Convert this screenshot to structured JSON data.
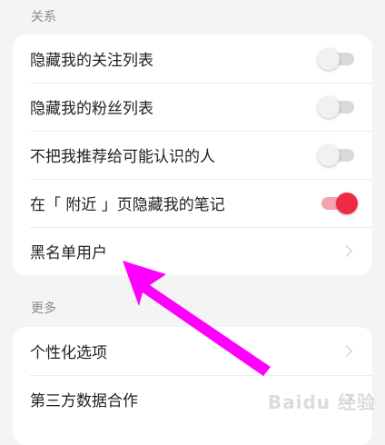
{
  "privacy_section": {
    "label": "关系",
    "items": [
      {
        "label": "隐藏我的关注列表",
        "control": "toggle",
        "on": false
      },
      {
        "label": "隐藏我的粉丝列表",
        "control": "toggle",
        "on": false
      },
      {
        "label": "不把我推荐给可能认识的人",
        "control": "toggle",
        "on": false
      },
      {
        "label": "在「 附近 」页隐藏我的笔记",
        "control": "toggle",
        "on": true
      },
      {
        "label": "黑名单用户",
        "control": "chevron"
      }
    ]
  },
  "more_section": {
    "label": "更多",
    "items": [
      {
        "label": "个性化选项",
        "control": "chevron"
      },
      {
        "label": "第三方数据合作",
        "control": "chevron"
      }
    ]
  },
  "watermark": "Baidu 经验",
  "colors": {
    "accent": "#ee2a44",
    "annotation_arrow": "#ff00ff"
  }
}
